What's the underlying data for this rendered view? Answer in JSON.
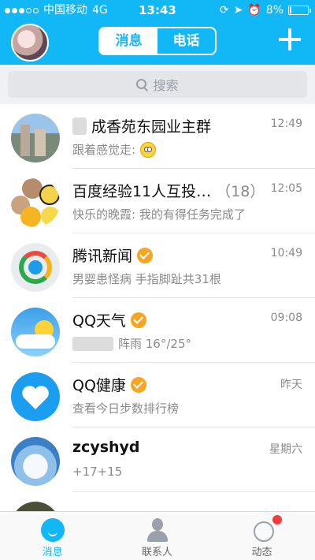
{
  "status_bar": {
    "carrier": "中国移动",
    "network": "4G",
    "time": "13:43",
    "battery": "8%",
    "battery_level": 0.08
  },
  "header": {
    "tabs": [
      {
        "label": "消息",
        "active": true
      },
      {
        "label": "电话",
        "active": false
      }
    ],
    "accent_color": "#12b7f5"
  },
  "search": {
    "placeholder": "搜索"
  },
  "conversations": [
    {
      "title": "成香苑东园业主群",
      "time": "12:49",
      "preview": "跟着感觉走:",
      "avatar": "building-photo",
      "title_blurred_prefix": true,
      "preview_emoji": "surprised-emoji"
    },
    {
      "title": "百度经验11人互投…",
      "count": "（18）",
      "time": "12:05",
      "preview": "快乐的晚霞: 我的有得任务完成了",
      "avatar": "group-avatar"
    },
    {
      "title": "腾讯新闻",
      "time": "10:49",
      "preview": "男婴患怪病 手指脚趾共31根",
      "avatar": "news-logo",
      "verified": true
    },
    {
      "title": "QQ天气",
      "time": "09:08",
      "preview": "阵雨 16°/25°",
      "avatar": "weather-logo",
      "verified": true,
      "preview_blurred_prefix": true
    },
    {
      "title": "QQ健康",
      "time": "昨天",
      "preview": "查看今日步数排行榜",
      "avatar": "health-logo",
      "verified": true
    },
    {
      "title": "zcyshyd",
      "time": "星期六",
      "preview": "+17+15",
      "avatar": "heart-cloud-photo"
    }
  ],
  "tabbar": {
    "tabs": [
      {
        "label": "消息",
        "icon": "chat-icon",
        "active": true
      },
      {
        "label": "联系人",
        "icon": "contacts-icon",
        "active": false
      },
      {
        "label": "动态",
        "icon": "star-icon",
        "active": false,
        "badge": true
      }
    ]
  }
}
